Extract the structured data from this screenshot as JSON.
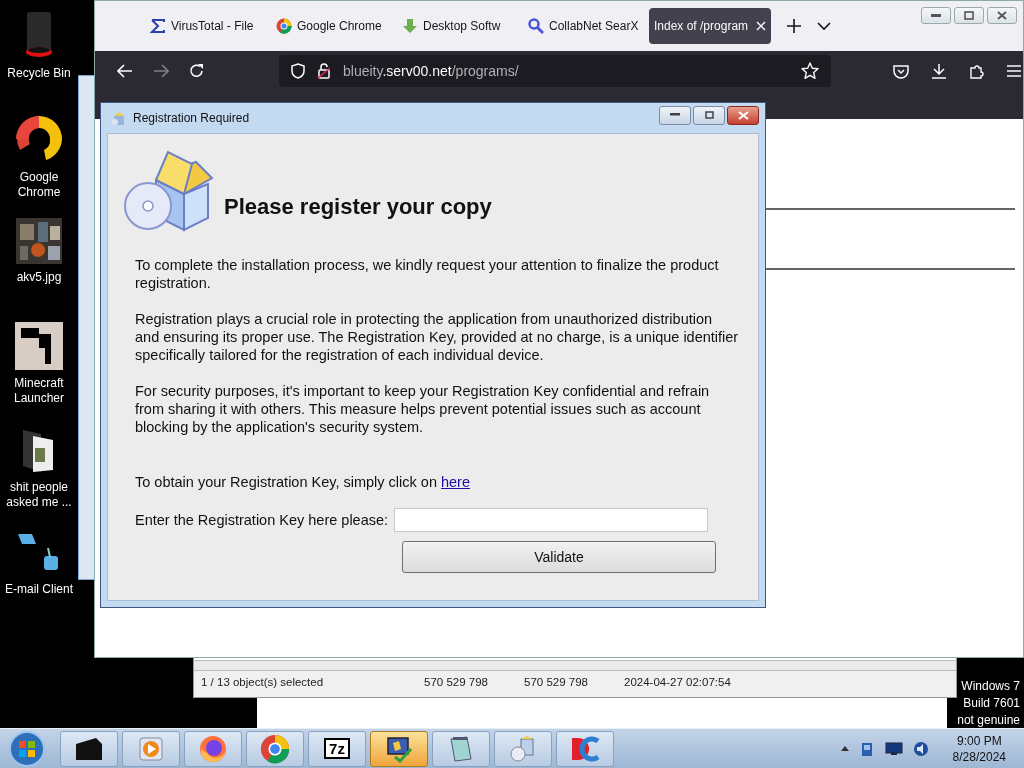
{
  "desktop_icons": [
    {
      "label": "Recycle Bin",
      "kind": "recycle"
    },
    {
      "label": "Google Chrome",
      "kind": "chrome"
    },
    {
      "label": "akv5.jpg"
    },
    {
      "label": "Minecraft Launcher",
      "kind": "minecraft"
    },
    {
      "label": "shit people asked me ...",
      "kind": "folder"
    },
    {
      "label": "E-mail Client",
      "kind": "email"
    }
  ],
  "file_manager": {
    "status_bar": [
      "1 / 13 object(s) selected",
      "570 529 798",
      "570 529 798",
      "2024-04-27 02:07:54"
    ]
  },
  "browser": {
    "tabs": [
      {
        "label": "VirusTotal - File",
        "kind": "sigma",
        "selected": false
      },
      {
        "label": "Google Chrome",
        "kind": "chrome",
        "selected": false
      },
      {
        "label": "Desktop Softw",
        "kind": "download",
        "selected": false
      },
      {
        "label": "CollabNet SearX",
        "kind": "search",
        "selected": false
      },
      {
        "label": "Index of /program",
        "kind": "plain",
        "selected": true
      }
    ],
    "forward_disabled": true,
    "address": {
      "subdomain": "blueity",
      "domain": ".serv00.net",
      "path": "/programs/"
    }
  },
  "dialog": {
    "title": "Registration Required",
    "heading": "Please register your copy",
    "paragraphs": [
      "To complete the installation process, we kindly request your attention to finalize the product registration.",
      "Registration plays a crucial role in protecting the application from unauthorized distribution and ensuring its proper use. The Registration Key, provided at no charge, is a unique identifier specifically tailored for the registration of each individual device.",
      "For security purposes, it's important to keep your Registration Key confidential and refrain from sharing it with others. This measure helps prevent potential issues such as account blocking by the application's security system."
    ],
    "link_prompt": "To obtain your Registration Key, simply click on",
    "link_text": "here",
    "key_label": "Enter the Registration Key here please:",
    "button": "Validate"
  },
  "genuine_notice": [
    "Windows 7",
    "Build 7601",
    "not genuine"
  ],
  "taskbar": {
    "apps": [
      {
        "kind": "terminal",
        "selected": false
      },
      {
        "kind": "media",
        "selected": false
      },
      {
        "kind": "firefox",
        "selected": false
      },
      {
        "kind": "chrome",
        "selected": false
      },
      {
        "kind": "sevenzip",
        "label": "7z",
        "selected": false
      },
      {
        "kind": "installer",
        "selected": true
      },
      {
        "kind": "notepad",
        "selected": false
      },
      {
        "kind": "setup",
        "selected": false
      },
      {
        "kind": "dc",
        "selected": false
      }
    ],
    "clock": {
      "time": "9:00 PM",
      "date": "8/28/2024"
    }
  }
}
